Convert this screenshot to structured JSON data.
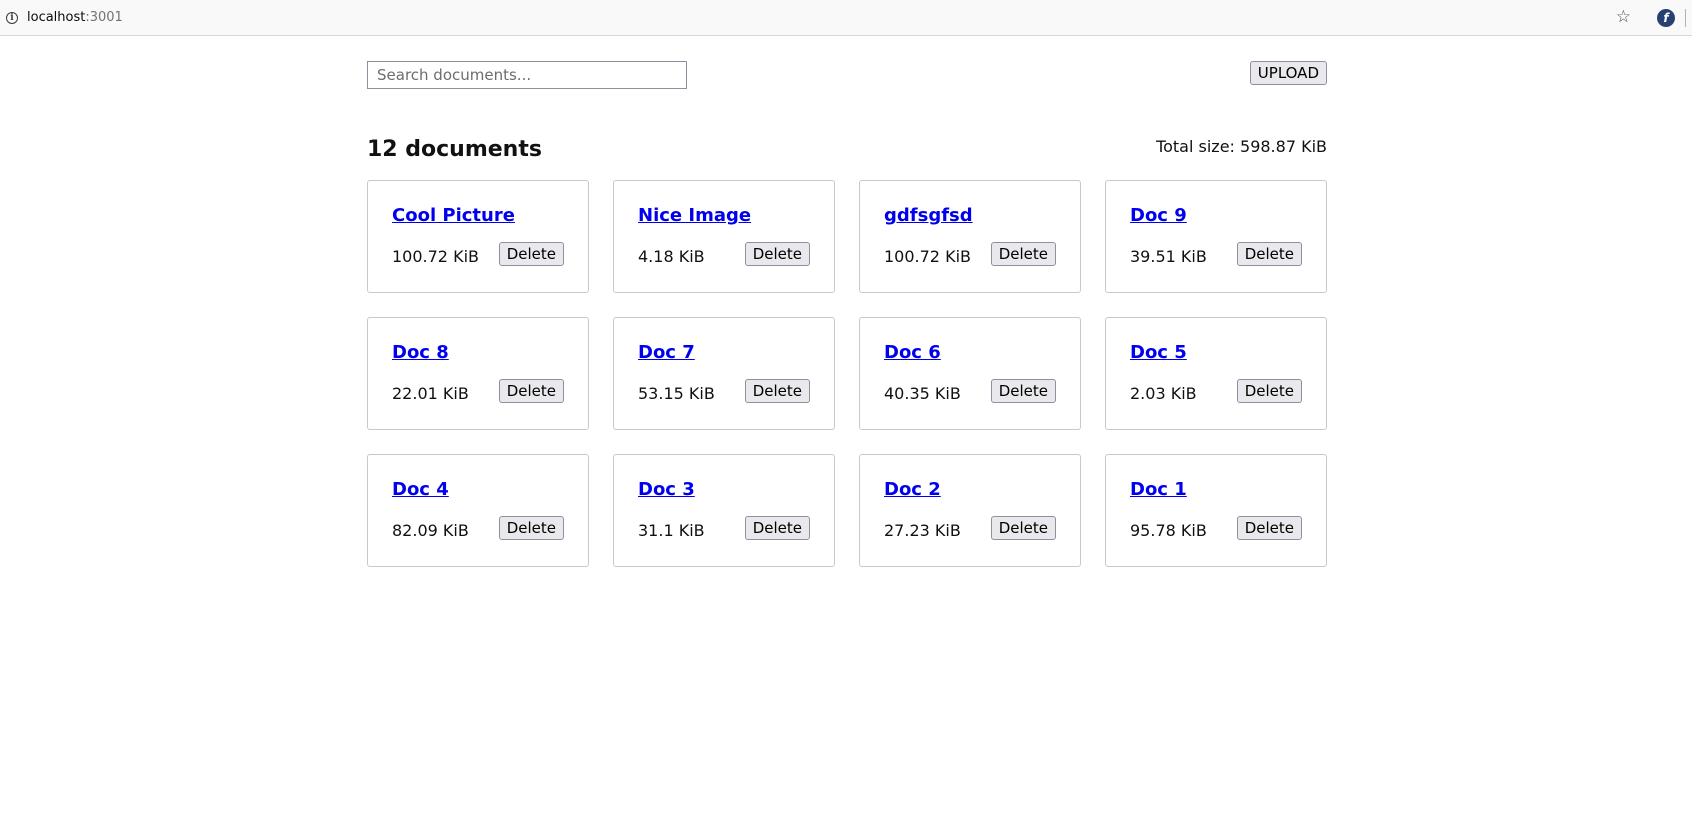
{
  "browser": {
    "host": "localhost",
    "port": ":3001"
  },
  "search": {
    "placeholder": "Search documents..."
  },
  "toolbar": {
    "upload_label": "UPLOAD"
  },
  "summary": {
    "count_label": "12 documents",
    "total_label": "Total size: 598.87 KiB"
  },
  "documents": [
    {
      "title": "Cool Picture",
      "size": "100.72 KiB",
      "delete_label": "Delete"
    },
    {
      "title": "Nice Image",
      "size": "4.18 KiB",
      "delete_label": "Delete"
    },
    {
      "title": "gdfsgfsd",
      "size": "100.72 KiB",
      "delete_label": "Delete"
    },
    {
      "title": "Doc 9",
      "size": "39.51 KiB",
      "delete_label": "Delete"
    },
    {
      "title": "Doc 8",
      "size": "22.01 KiB",
      "delete_label": "Delete"
    },
    {
      "title": "Doc 7",
      "size": "53.15 KiB",
      "delete_label": "Delete"
    },
    {
      "title": "Doc 6",
      "size": "40.35 KiB",
      "delete_label": "Delete"
    },
    {
      "title": "Doc 5",
      "size": "2.03 KiB",
      "delete_label": "Delete"
    },
    {
      "title": "Doc 4",
      "size": "82.09 KiB",
      "delete_label": "Delete"
    },
    {
      "title": "Doc 3",
      "size": "31.1 KiB",
      "delete_label": "Delete"
    },
    {
      "title": "Doc 2",
      "size": "27.23 KiB",
      "delete_label": "Delete"
    },
    {
      "title": "Doc 1",
      "size": "95.78 KiB",
      "delete_label": "Delete"
    }
  ],
  "colors": {
    "link": "#0000ee",
    "card_border": "#c9c9c9",
    "button_bg": "#e9e9ed"
  },
  "icons": {
    "site_info": "info-icon",
    "bookmark": "star-icon",
    "extension": "fedora-icon"
  }
}
